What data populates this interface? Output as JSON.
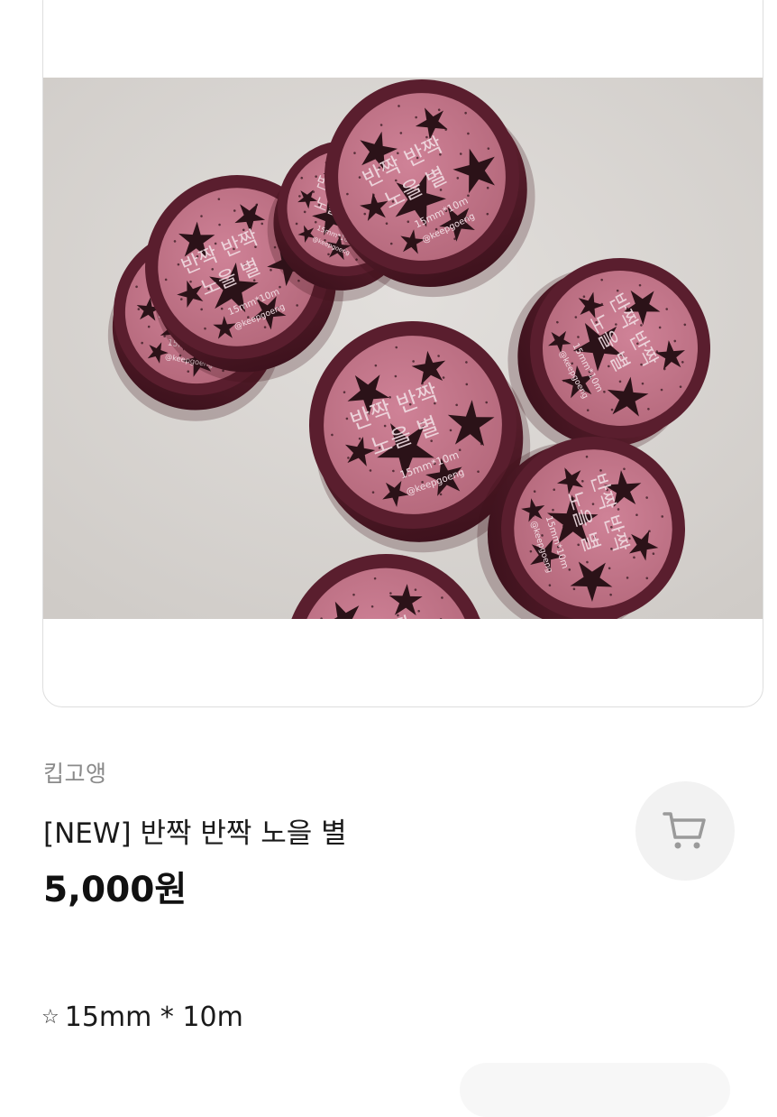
{
  "product": {
    "shop_name": "킵고앵",
    "title": "[NEW] 반짝 반짝 노을 별",
    "price": "5,000원",
    "spec_icon": "☆",
    "spec_text": "15mm * 10m"
  },
  "photo": {
    "tape_line1": "반짝 반짝",
    "tape_line2": "노을 별",
    "tape_size": "15mm*10m",
    "tape_handle": "@keepgoeng"
  },
  "icons": {
    "cart": "cart-icon",
    "spec_star": "star-outline-icon"
  },
  "colors": {
    "tape_rim": "#5a1e2e",
    "tape_face": "#c27487",
    "star": "#2b1218",
    "background": "#d9d6d3"
  }
}
